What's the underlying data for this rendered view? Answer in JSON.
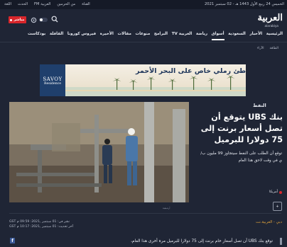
{
  "topbar": {
    "date": "الخميس 24 ربيع الأول 1443 هـ - 02 سبتمبر 2021",
    "links": [
      "القناة",
      "من الحرمين",
      "العربية FM",
      "الحدث",
      "اللغة"
    ]
  },
  "header": {
    "logo_ar": "العربية",
    "logo_en": "alarabiya",
    "live_label": "مباشر"
  },
  "nav": {
    "items": [
      "الرئيسية",
      "الأخبار",
      "السعودية",
      "أسواق",
      "رياضة",
      "العربية TV",
      "البرامج",
      "منوعات",
      "مقالات",
      "الأخيرة",
      "فيروس كورونا",
      "القافلة",
      "بودكاست"
    ],
    "active_index": 3
  },
  "subnav": {
    "items": [
      "الطاقة",
      "الآراء"
    ]
  },
  "ad": {
    "brand": "SAVOY",
    "brand_sub": "Residence",
    "headline": "شاطئ رملي خاص على البحر الأحمر"
  },
  "article": {
    "tag": "النفط",
    "headline": "بنك UBS يتوقع أن تصل أسعار برنت إلى 75 دولارا للبرميل",
    "summary": "توقع أن الطلب على النفط سيتجاوز 99 مليون ب/ي في وقت لاحق هذا العام",
    "country": "أمريكا",
    "follow_label": "+",
    "source": "دبي - العربية.نت",
    "published": "نشر في: 01 سبتمبر ,2021: 09:59 م GST",
    "updated": "آخر تحديث: 01 سبتمبر ,2021: 10:17 م GST",
    "body_first_line": "توقع بنك UBS أن تصل أسعار خام برنت إلى 75 دولارا للبرميل مرة أخرى هذا العام،",
    "photo_credit": "أرشيفية"
  },
  "colors": {
    "background": "#1f2535",
    "live_red": "#d8262b",
    "source_orange": "#e0a23a"
  }
}
